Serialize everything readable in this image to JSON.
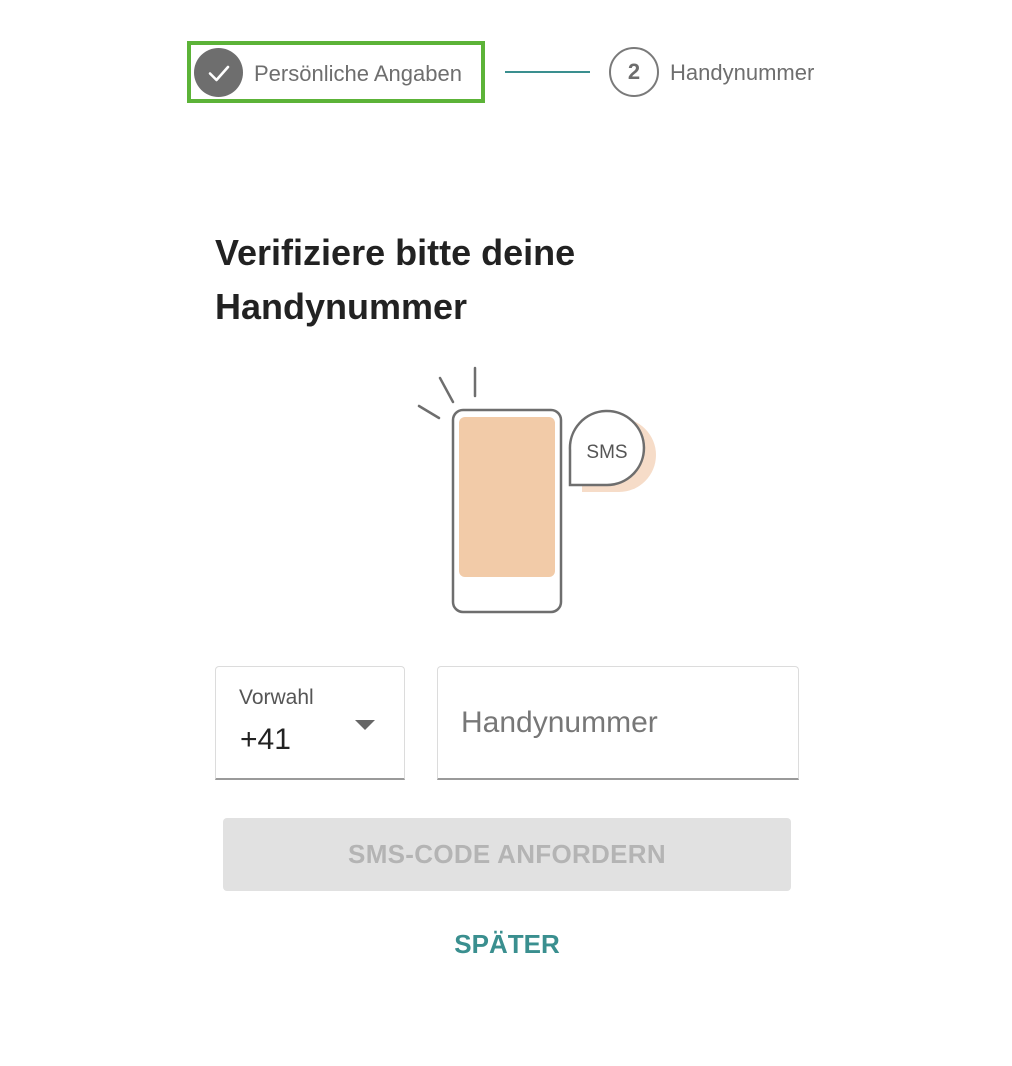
{
  "stepper": {
    "step1": {
      "label": "Persönliche Angaben",
      "status": "completed",
      "icon": "check-icon"
    },
    "step2": {
      "number": "2",
      "label": "Handynummer",
      "status": "active"
    },
    "colors": {
      "completed_circle": "#6e6e6e",
      "highlight_border": "#5cb338",
      "connector": "#3a8f8f"
    }
  },
  "main": {
    "heading": "Verifiziere bitte deine Handynummer"
  },
  "illustration": {
    "icon": "phone-sms-illustration",
    "bubble_text": "SMS",
    "colors": {
      "screen": "#f2cba8",
      "outline": "#6e6e6e"
    }
  },
  "form": {
    "prefix": {
      "label": "Vorwahl",
      "value": "+41"
    },
    "phone": {
      "placeholder": "Handynummer",
      "value": ""
    },
    "submit_label": "SMS-CODE ANFORDERN",
    "submit_disabled": true,
    "later_label": "SPÄTER"
  },
  "theme": {
    "accent": "#3a8f8f",
    "disabled_bg": "#e1e1e1",
    "disabled_text": "#b4b4b4"
  }
}
